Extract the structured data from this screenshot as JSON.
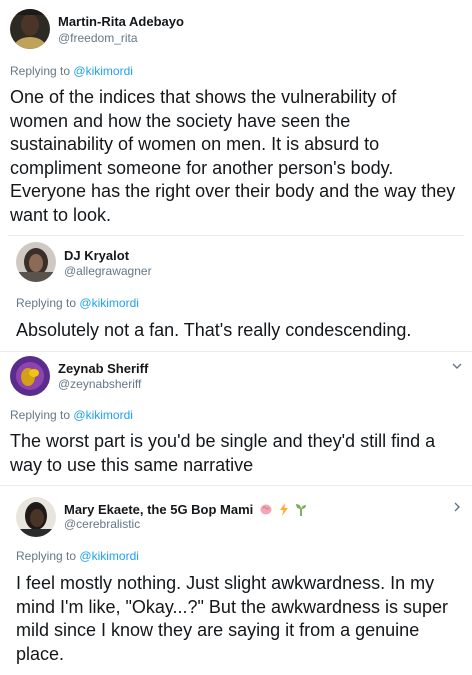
{
  "tweets": [
    {
      "name": "Martin-Rita Adebayo",
      "handle": "@freedom_rita",
      "replying_prefix": "Replying to",
      "replying_to": "@kikimordi",
      "lines": [
        "One of the indices that shows the vulnerability of",
        "women and how the society have seen the",
        "sustainability of women on men. It is absurd to",
        "compliment someone for another person's body.",
        "Everyone has the right over their body and the way they",
        "want to look."
      ]
    },
    {
      "name": "DJ Kryalot",
      "handle": "@allegrawagner",
      "replying_prefix": "Replying to",
      "replying_to": "@kikimordi",
      "lines": [
        "Absolutely not a fan. That's really condescending."
      ]
    },
    {
      "name": "Zeynab Sheriff",
      "handle": "@zeynabsheriff",
      "replying_prefix": "Replying to",
      "replying_to": "@kikimordi",
      "lines": [
        "The worst part is you'd be single and they'd still find a",
        "way to use this same narrative"
      ]
    },
    {
      "name": "Mary Ekaete, the 5G Bop Mami",
      "handle": "@cerebralistic",
      "replying_prefix": "Replying to",
      "replying_to": "@kikimordi",
      "lines": [
        "I feel mostly nothing. Just slight awkwardness. In my",
        "mind I'm like, \"Okay...?\" But the awkwardness is super",
        "mild since I know they are saying it from a genuine",
        "place."
      ],
      "name_emojis": [
        "brain-emoji",
        "lightning-emoji",
        "seedling-emoji"
      ]
    }
  ],
  "colors": {
    "link": "#1da1f2",
    "secondary_text": "#657786",
    "primary_text": "#14171a",
    "divider": "#e6ecf0"
  }
}
